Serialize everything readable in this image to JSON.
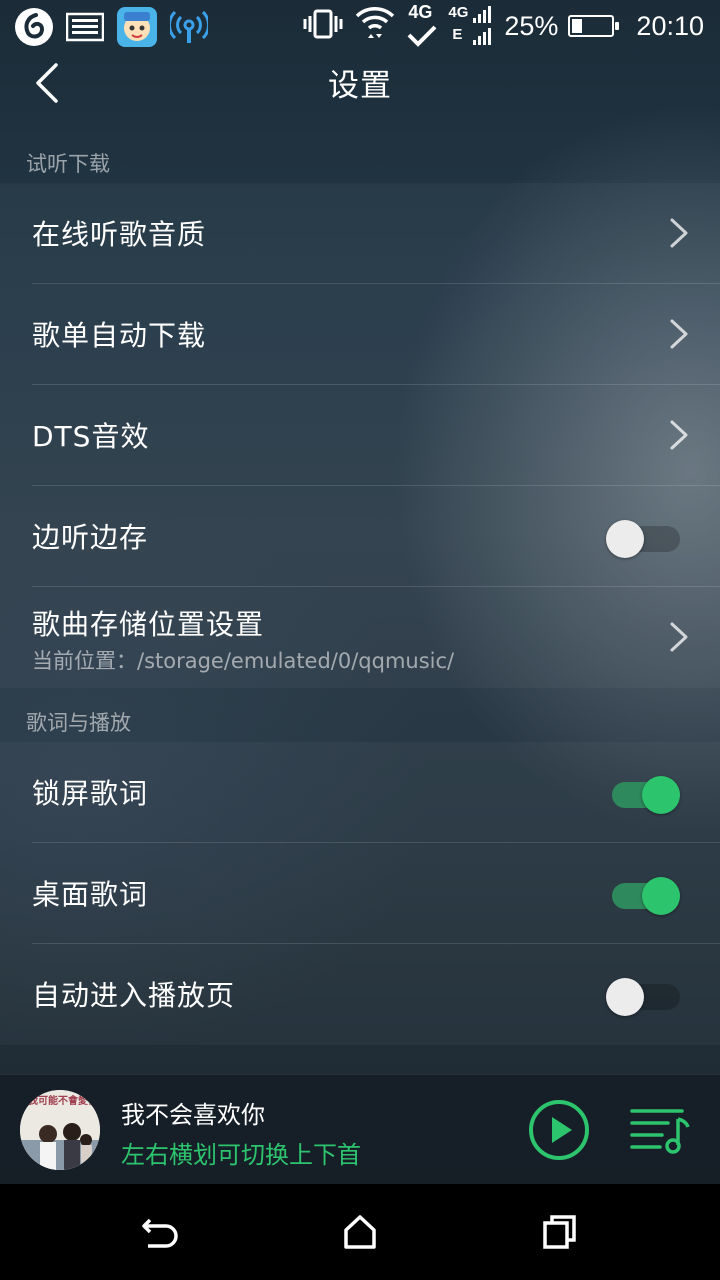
{
  "status_bar": {
    "battery": "25%",
    "battery_level": 0.25,
    "time": "20:10",
    "network_4g": "4G",
    "network_e": "E",
    "icons": [
      "netease-icon",
      "message-icon",
      "app-avatar-icon",
      "hotspot-icon",
      "vibrate-icon",
      "wifi-icon",
      "4g-check-icon",
      "signal-icon",
      "battery-icon"
    ]
  },
  "header": {
    "title": "设置",
    "back_icon": "chevron-left-icon"
  },
  "sections": [
    {
      "label": "试听下载",
      "items": [
        {
          "label": "在线听歌音质",
          "control": "chevron"
        },
        {
          "label": "歌单自动下载",
          "control": "chevron"
        },
        {
          "label": "DTS音效",
          "control": "chevron"
        },
        {
          "label": "边听边存",
          "control": "toggle",
          "on": false
        },
        {
          "label": "歌曲存储位置设置",
          "sublabel": "当前位置：/storage/emulated/0/qqmusic/",
          "control": "chevron"
        }
      ]
    },
    {
      "label": "歌词与播放",
      "items": [
        {
          "label": "锁屏歌词",
          "control": "toggle",
          "on": true
        },
        {
          "label": "桌面歌词",
          "control": "toggle",
          "on": true
        },
        {
          "label": "自动进入播放页",
          "control": "toggle",
          "on": false
        }
      ]
    }
  ],
  "player": {
    "song_title": "我不会喜欢你",
    "hint": "左右横划可切换上下首",
    "album_caption": "我可能不會愛你",
    "accent": "#2dc46e"
  },
  "nav": {
    "back": "back-icon",
    "home": "home-icon",
    "recents": "recents-icon"
  }
}
